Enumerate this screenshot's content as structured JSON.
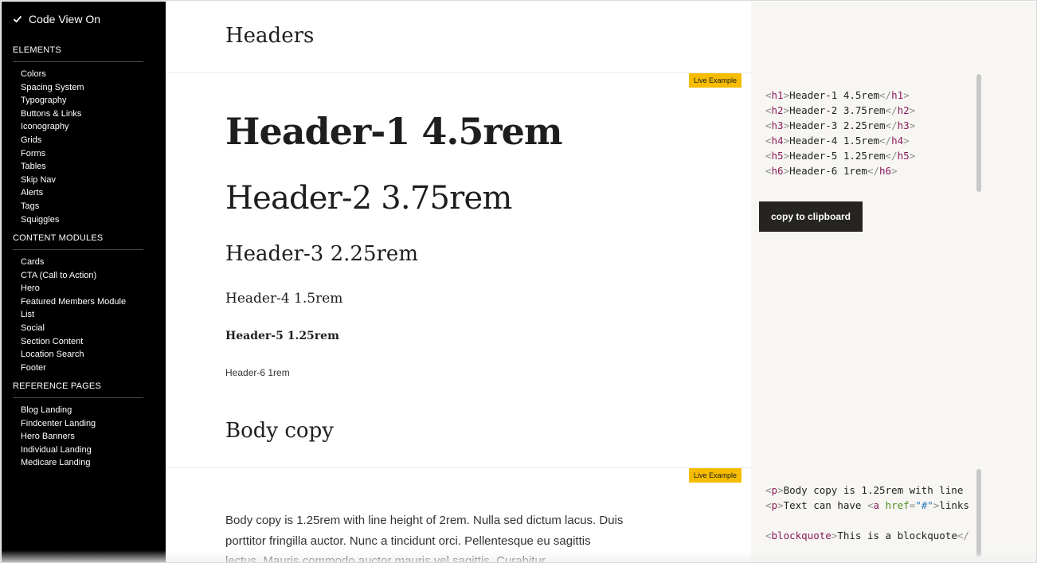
{
  "sidebar": {
    "code_view_label": "Code View On",
    "sections": [
      {
        "heading": "ELEMENTS",
        "items": [
          "Colors",
          "Spacing System",
          "Typography",
          "Buttons & Links",
          "Iconography",
          "Grids",
          "Forms",
          "Tables",
          "Skip Nav",
          "Alerts",
          "Tags",
          "Squiggles"
        ]
      },
      {
        "heading": "CONTENT MODULES",
        "items": [
          "Cards",
          "CTA (Call to Action)",
          "Hero",
          "Featured Members Module",
          "List",
          "Social",
          "Section Content",
          "Location Search",
          "Footer"
        ]
      },
      {
        "heading": "REFERENCE PAGES",
        "items": [
          "Blog Landing",
          "Findcenter Landing",
          "Hero Banners",
          "Individual Landing",
          "Medicare Landing"
        ]
      }
    ]
  },
  "headers_section": {
    "title": "Headers",
    "badge": "Live Example",
    "samples": [
      "Header-1 4.5rem",
      "Header-2 3.75rem",
      "Header-3 2.25rem",
      "Header-4 1.5rem",
      "Header-5 1.25rem",
      "Header-6 1rem"
    ]
  },
  "body_section": {
    "title": "Body copy",
    "badge": "Live Example",
    "text": "Body copy is 1.25rem with line height of 2rem. Nulla sed dictum lacus. Duis porttitor fringilla auctor. Nunc a tincidunt orci. Pellentesque eu sagittis lectus. Mauris commodo auctor mauris vel sagittis. Curabitur"
  },
  "code": {
    "headers_lines": [
      {
        "tag": "h1",
        "text": "Header-1 4.5rem"
      },
      {
        "tag": "h2",
        "text": "Header-2 3.75rem"
      },
      {
        "tag": "h3",
        "text": "Header-3 2.25rem"
      },
      {
        "tag": "h4",
        "text": "Header-4 1.5rem"
      },
      {
        "tag": "h5",
        "text": "Header-5 1.25rem"
      },
      {
        "tag": "h6",
        "text": "Header-6 1rem"
      }
    ],
    "copy_button": "copy to clipboard",
    "body_line1_tag": "p",
    "body_line1_text": "Body copy is 1.25rem with line",
    "body_line2_tag": "p",
    "body_line2_text": "Text can have ",
    "body_line2_a_tag": "a",
    "body_line2_attr": "href",
    "body_line2_eq": "=",
    "body_line2_value": "\"#\"",
    "body_line2_tail": "links",
    "body_line3_tag": "blockquote",
    "body_line3_text": "This is a blockquote",
    "body_line3_close": "</"
  },
  "icons": {
    "checkbox": "checkmark-icon"
  }
}
